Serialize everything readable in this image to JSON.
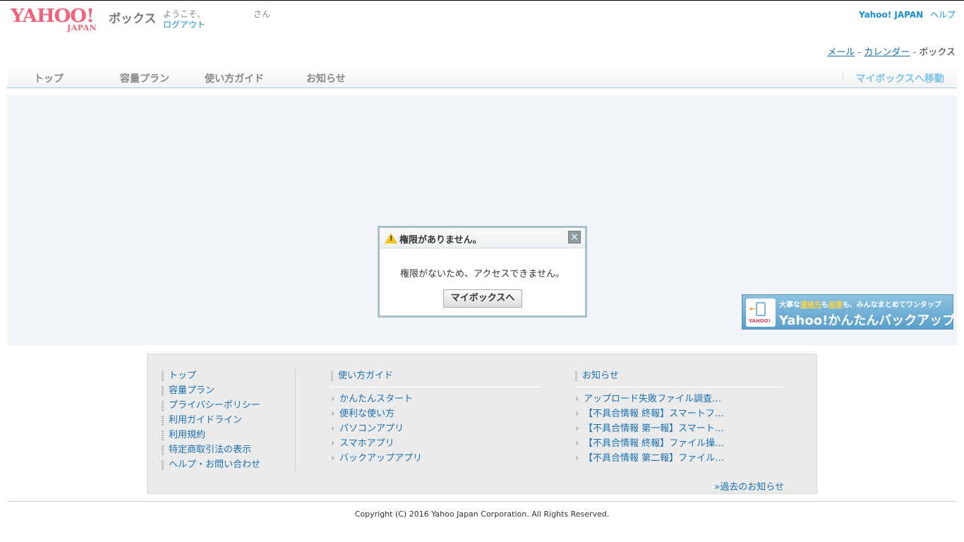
{
  "header": {
    "logo_text": "YAHOO!",
    "logo_sub": "JAPAN",
    "service_name": "ボックス",
    "welcome": "ようこそ、",
    "san": "さん",
    "logout": "ログアウト",
    "yahoo_japan": "Yahoo! JAPAN",
    "help": "ヘルプ",
    "service_links": {
      "mail": "メール",
      "sep1": " - ",
      "calendar": "カレンダー",
      "sep2": " - ",
      "box": "ボックス"
    }
  },
  "nav": {
    "items": [
      "トップ",
      "容量プラン",
      "使い方ガイド",
      "お知らせ"
    ],
    "my_box": "マイボックスへ移動"
  },
  "dialog": {
    "title": "権限がありません。",
    "message": "権限がないため、アクセスできません。",
    "button": "マイボックスへ",
    "close": "×",
    "warn_glyph": "!"
  },
  "banner": {
    "top_pre": "大事な",
    "top_hl1": "連絡先",
    "top_mid": "も",
    "top_hl2": "画像",
    "top_post": "も、みんなまとめてワンタップ",
    "main": "Yahoo!かんたんバックアップ",
    "icon_logo": "YAHOO!",
    "icon_arrow": "←"
  },
  "footer": {
    "col1": [
      "トップ",
      "容量プラン",
      "プライバシーポリシー",
      "利用ガイドライン",
      "利用規約",
      "特定商取引法の表示",
      "ヘルプ・お問い合わせ"
    ],
    "guide_title": "使い方ガイド",
    "guide_links": [
      "かんたんスタート",
      "便利な使い方",
      "パソコンアプリ",
      "スマホアプリ",
      "バックアップアプリ"
    ],
    "news_title": "お知らせ",
    "news_links": [
      "アップロード失敗ファイル調査…",
      "【不具合情報 終報】スマートフ…",
      "【不具合情報 第一報】スマート…",
      "【不具合情報 終報】ファイル操…",
      "【不具合情報 第二報】ファイル…"
    ],
    "news_more": "»過去のお知らせ"
  },
  "copyright": "Copyright (C) 2016 Yahoo Japan Corporation. All Rights Reserved."
}
